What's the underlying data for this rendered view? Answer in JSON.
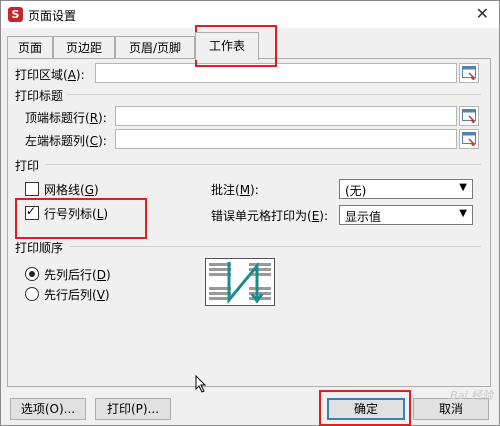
{
  "window": {
    "title": "页面设置",
    "app_icon": "S"
  },
  "tabs": [
    {
      "label": "页面"
    },
    {
      "label": "页边距"
    },
    {
      "label": "页眉/页脚"
    },
    {
      "label": "工作表"
    }
  ],
  "print_area": {
    "label": "打印区域(",
    "key": "A",
    "suffix": "):",
    "value": ""
  },
  "print_titles": {
    "heading": "打印标题",
    "top_rows": {
      "label": "顶端标题行(",
      "key": "R",
      "suffix": "):",
      "value": ""
    },
    "left_cols": {
      "label": "左端标题列(",
      "key": "C",
      "suffix": "):",
      "value": ""
    }
  },
  "print": {
    "heading": "打印",
    "gridlines": {
      "label": "网格线(",
      "key": "G",
      "suffix": ")",
      "checked": false
    },
    "row_col_headers": {
      "label": "行号列标(",
      "key": "L",
      "suffix": ")",
      "checked": true
    },
    "comments": {
      "label": "批注(",
      "key": "M",
      "suffix": "):",
      "value": "(无)"
    },
    "cell_errors": {
      "label": "错误单元格打印为(",
      "key": "E",
      "suffix": "):",
      "value": "显示值"
    }
  },
  "page_order": {
    "heading": "打印顺序",
    "down_then_over": {
      "label": "先列后行(",
      "key": "D",
      "suffix": ")",
      "selected": true
    },
    "over_then_down": {
      "label": "先行后列(",
      "key": "V",
      "suffix": ")",
      "selected": false
    }
  },
  "buttons": {
    "options": "选项(O)...",
    "print": "打印(P)...",
    "ok": "确定",
    "cancel": "取消"
  },
  "watermark": "Bai 经验",
  "colors": {
    "highlight": "#e02020",
    "accent": "#3c7fb1",
    "preview_arrow": "#1a8c8c"
  }
}
